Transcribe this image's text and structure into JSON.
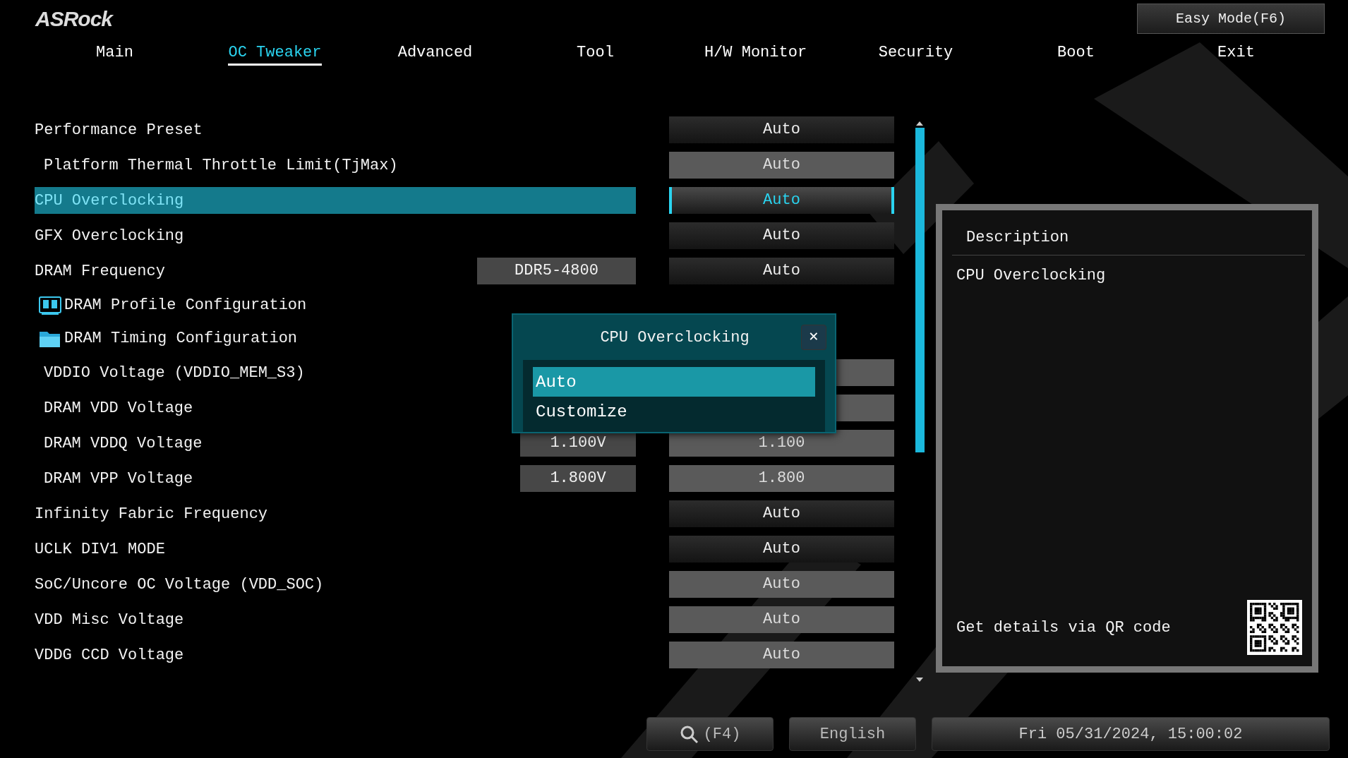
{
  "logo": "ASRock",
  "easy_mode_button": "Easy Mode(F6)",
  "tabs": [
    {
      "label": "Main",
      "selected": false
    },
    {
      "label": "OC Tweaker",
      "selected": true
    },
    {
      "label": "Advanced",
      "selected": false
    },
    {
      "label": "Tool",
      "selected": false
    },
    {
      "label": "H/W Monitor",
      "selected": false
    },
    {
      "label": "Security",
      "selected": false
    },
    {
      "label": "Boot",
      "selected": false
    },
    {
      "label": "Exit",
      "selected": false
    }
  ],
  "settings": [
    {
      "kind": "select",
      "label": "Performance Preset",
      "indented": false,
      "selected": false,
      "value": "Auto"
    },
    {
      "kind": "input",
      "label": "Platform Thermal Throttle Limit(TjMax)",
      "indented": true,
      "selected": false,
      "value": "Auto"
    },
    {
      "kind": "select",
      "label": "CPU Overclocking",
      "indented": false,
      "selected": true,
      "value": "Auto"
    },
    {
      "kind": "select",
      "label": "GFX Overclocking",
      "indented": false,
      "selected": false,
      "value": "Auto"
    },
    {
      "kind": "select",
      "label": "DRAM Frequency",
      "indented": false,
      "selected": false,
      "current": "DDR5-4800",
      "value": "Auto"
    },
    {
      "kind": "submenu",
      "label": "DRAM Profile Configuration",
      "indented": false,
      "selected": false
    },
    {
      "kind": "submenu",
      "label": "DRAM Timing Configuration",
      "indented": false,
      "selected": false
    },
    {
      "kind": "input",
      "label": "VDDIO Voltage (VDDIO_MEM_S3)",
      "indented": true,
      "selected": false
    },
    {
      "kind": "input",
      "label": "DRAM VDD Voltage",
      "indented": true,
      "selected": false
    },
    {
      "kind": "input",
      "label": "DRAM VDDQ Voltage",
      "indented": true,
      "selected": false,
      "current": "1.100V",
      "value": "1.100"
    },
    {
      "kind": "input",
      "label": "DRAM VPP Voltage",
      "indented": true,
      "selected": false,
      "current": "1.800V",
      "value": "1.800"
    },
    {
      "kind": "select",
      "label": "Infinity Fabric Frequency",
      "indented": false,
      "selected": false,
      "value": "Auto"
    },
    {
      "kind": "select",
      "label": "UCLK DIV1 MODE",
      "indented": false,
      "selected": false,
      "value": "Auto"
    },
    {
      "kind": "input",
      "label": "SoC/Uncore OC Voltage (VDD_SOC)",
      "indented": false,
      "selected": false,
      "value": "Auto"
    },
    {
      "kind": "input",
      "label": "VDD Misc Voltage",
      "indented": false,
      "selected": false,
      "value": "Auto"
    },
    {
      "kind": "input",
      "label": "VDDG CCD Voltage",
      "indented": false,
      "selected": false,
      "value": "Auto"
    }
  ],
  "popup": {
    "title": "CPU Overclocking",
    "close": "✕",
    "options": [
      {
        "label": "Auto",
        "selected": true
      },
      {
        "label": "Customize",
        "selected": false
      }
    ]
  },
  "description": {
    "title": "Description",
    "text": "CPU Overclocking",
    "qr_label": "Get details via QR code"
  },
  "footer": {
    "search": "(F4)",
    "language": "English",
    "datetime": "Fri 05/31/2024, 15:00:02"
  }
}
